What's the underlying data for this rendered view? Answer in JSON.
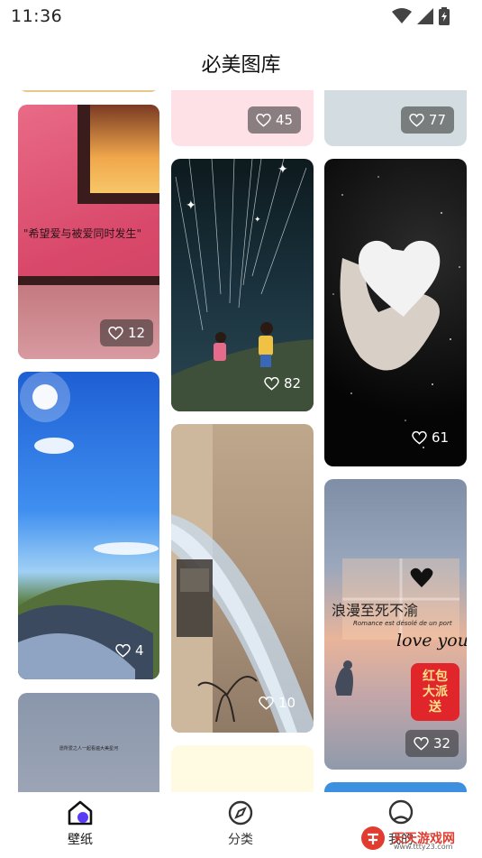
{
  "status": {
    "time": "11:36"
  },
  "header": {
    "title": "必美图库"
  },
  "cards": {
    "c1": {
      "likes": "45"
    },
    "c2": {
      "likes": "77"
    },
    "c3": {
      "likes": "12",
      "caption": "\"希望爱与被爱同时发生\""
    },
    "c4": {
      "likes": "82"
    },
    "c5": {
      "likes": "61"
    },
    "c6": {
      "likes": "4"
    },
    "c7": {
      "likes": "10"
    },
    "c8": {
      "likes": "32",
      "caption_cn": "浪漫至死不渝",
      "caption_fr": "Romance est désolé de un port",
      "caption_en": "love you",
      "badge": "红包大派送"
    },
    "c9": {
      "caption": "愿所爱之人一起看遍大美星河"
    }
  },
  "tabs": [
    {
      "label": "壁纸",
      "icon": "home-icon",
      "active": true
    },
    {
      "label": "分类",
      "icon": "compass-icon",
      "active": false
    },
    {
      "label": "我的",
      "icon": "profile-icon",
      "active": false
    }
  ],
  "watermark": {
    "text": "天天游戏网",
    "url": "www.ttty23.com"
  },
  "colors": {
    "accent": "#5b3cf5",
    "like_badge": "rgba(45,45,45,0.55)"
  }
}
